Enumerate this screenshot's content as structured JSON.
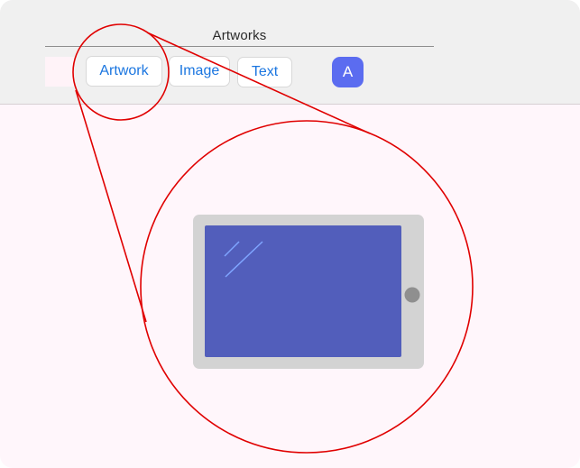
{
  "header": {
    "title": "Artworks",
    "tabs": [
      {
        "label": "Artwork",
        "selected": true
      },
      {
        "label": "Image",
        "selected": false
      },
      {
        "label": "Text",
        "selected": false
      }
    ],
    "avatar_letter": "A"
  },
  "colors": {
    "header_bg": "#f0f0f0",
    "canvas_bg": "#fff6fb",
    "tab_text": "#1b76e0",
    "avatar_bg": "#5b6cf0",
    "highlight_red": "#e00000",
    "tablet_body": "#d3d3d3",
    "tablet_screen": "#525ebb",
    "tablet_button": "#8f8f8f"
  },
  "illustration": {
    "subject": "tablet-icon"
  }
}
